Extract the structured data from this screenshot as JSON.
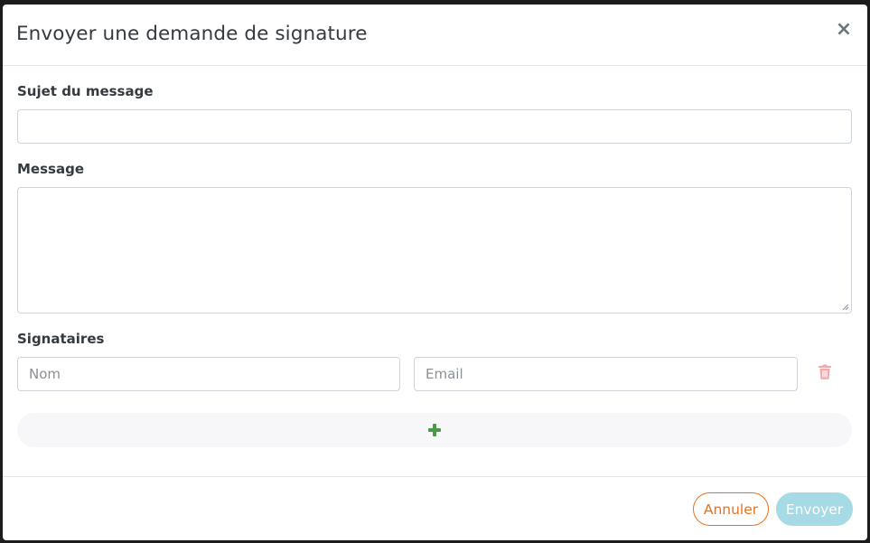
{
  "modal": {
    "title": "Envoyer une demande de signature",
    "close_label": "×"
  },
  "form": {
    "subject_label": "Sujet du message",
    "subject_value": "",
    "message_label": "Message",
    "message_value": "",
    "signers_label": "Signataires",
    "signer_name_placeholder": "Nom",
    "signer_email_placeholder": "Email",
    "add_signer_icon": "plus-icon",
    "delete_signer_icon": "trash-icon"
  },
  "footer": {
    "cancel_label": "Annuler",
    "send_label": "Envoyer"
  },
  "colors": {
    "cancel_accent": "#e8711d",
    "send_disabled": "#a6dae4",
    "add_icon": "#4a9a4a",
    "trash_icon": "#f2a9ae"
  }
}
